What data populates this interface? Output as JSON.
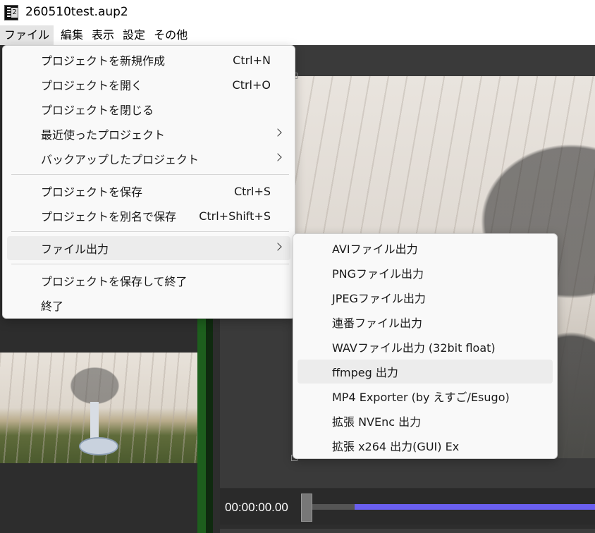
{
  "window": {
    "title": "260510test.aup2",
    "icon": "film-icon"
  },
  "menubar": {
    "items": [
      "ファイル",
      "編集",
      "表示",
      "設定",
      "その他"
    ],
    "active_index": 0
  },
  "file_menu": {
    "items": [
      {
        "label": "プロジェクトを新規作成",
        "shortcut": "Ctrl+N"
      },
      {
        "label": "プロジェクトを開く",
        "shortcut": "Ctrl+O"
      },
      {
        "label": "プロジェクトを閉じる",
        "shortcut": ""
      },
      {
        "label": "最近使ったプロジェクト",
        "shortcut": "",
        "submenu": true
      },
      {
        "label": "バックアップしたプロジェクト",
        "shortcut": "",
        "submenu": true
      },
      {
        "label": "プロジェクトを保存",
        "shortcut": "Ctrl+S"
      },
      {
        "label": "プロジェクトを別名で保存",
        "shortcut": "Ctrl+Shift+S"
      },
      {
        "label": "ファイル出力",
        "shortcut": "",
        "submenu": true,
        "highlighted": true
      },
      {
        "label": "プロジェクトを保存して終了",
        "shortcut": ""
      },
      {
        "label": "終了",
        "shortcut": ""
      }
    ]
  },
  "export_submenu": {
    "items": [
      "AVIファイル出力",
      "PNGファイル出力",
      "JPEGファイル出力",
      "連番ファイル出力",
      "WAVファイル出力 (32bit float)",
      "ffmpeg 出力",
      "MP4 Exporter (by えすご/Esugo)",
      "拡張 NVEnc 出力",
      "拡張 x264 出力(GUI) Ex"
    ],
    "highlighted_index": 5
  },
  "player": {
    "timecode": "00:00:00.00",
    "accent_color": "#6a5ff0"
  }
}
